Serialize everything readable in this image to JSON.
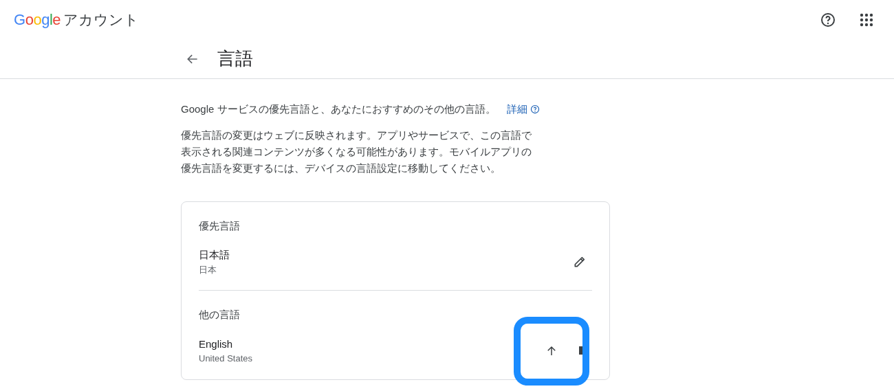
{
  "header": {
    "logo": "Google",
    "product": "アカウント"
  },
  "page": {
    "title": "言語"
  },
  "intro": {
    "text": "Google サービスの優先言語と、あなたにおすすめのその他の言語。",
    "link": "詳細"
  },
  "note_lines": [
    "優先言語の変更はウェブに反映されます。アプリやサービスで、この言語で",
    "表示される関連コンテンツが多くなる可能性があります。モバイルアプリの",
    "優先言語を変更するには、デバイスの言語設定に移動してください。"
  ],
  "sections": [
    {
      "heading": "優先言語",
      "languages": [
        {
          "name": "日本語",
          "region": "日本",
          "kind": "primary",
          "highlighted": false
        }
      ]
    },
    {
      "heading": "他の言語",
      "languages": [
        {
          "name": "English",
          "region": "United States",
          "kind": "other",
          "highlighted": true
        }
      ]
    }
  ]
}
